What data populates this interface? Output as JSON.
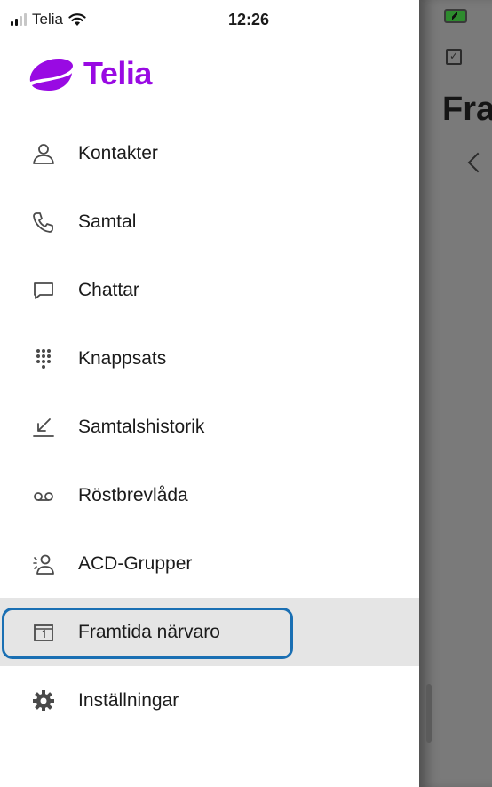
{
  "status_bar": {
    "carrier": "Telia",
    "time": "12:26"
  },
  "brand": {
    "name": "Telia",
    "color": "#990AE3"
  },
  "menu": {
    "items": [
      {
        "label": "Kontakter",
        "icon": "person-icon"
      },
      {
        "label": "Samtal",
        "icon": "phone-icon"
      },
      {
        "label": "Chattar",
        "icon": "chat-bubble-icon"
      },
      {
        "label": "Knappsats",
        "icon": "keypad-icon"
      },
      {
        "label": "Samtalshistorik",
        "icon": "call-history-icon"
      },
      {
        "label": "Röstbrevlåda",
        "icon": "voicemail-icon"
      },
      {
        "label": "ACD-Grupper",
        "icon": "group-icon"
      },
      {
        "label": "Framtida närvaro",
        "icon": "calendar-icon",
        "selected": true
      },
      {
        "label": "Inställningar",
        "icon": "gear-icon"
      }
    ]
  },
  "background_page": {
    "title_fragment": "Fra"
  },
  "colors": {
    "highlight_outline": "#1A6FB3",
    "selected_row": "#E5E5E5",
    "overlay": "#7A7A7A"
  }
}
